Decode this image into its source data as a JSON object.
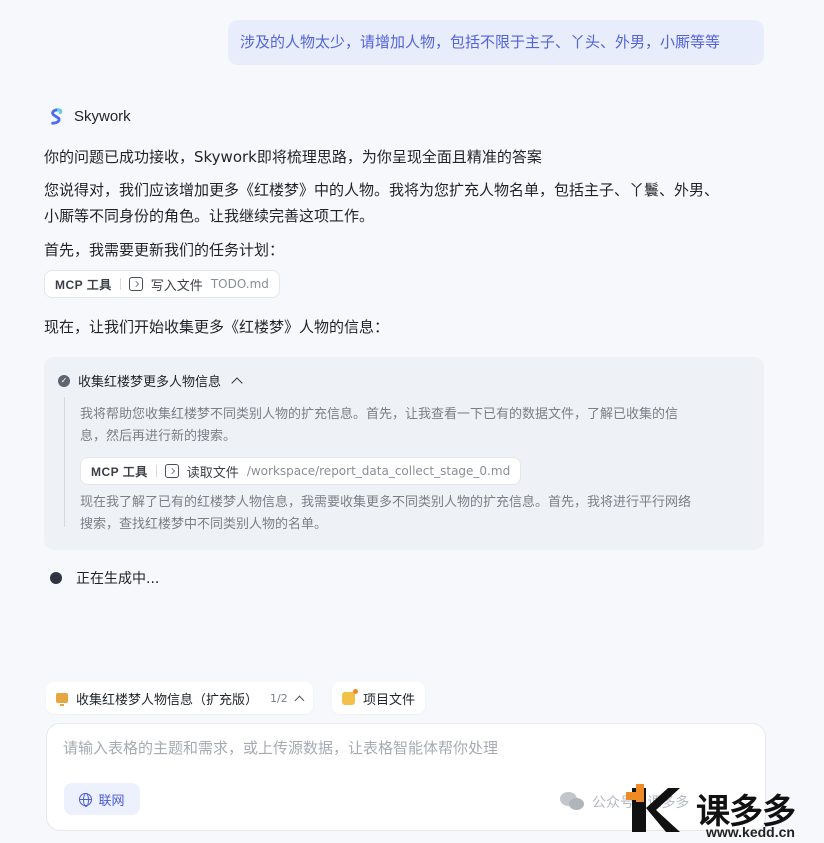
{
  "user_message": "涉及的人物太少，请增加人物，包括不限于主子、丫头、外男，小厮等等",
  "assistant": {
    "name": "Skywork",
    "paragraphs": [
      "你的问题已成功接收，Skywork即将梳理思路，为你呈现全面且精准的答案",
      "您说得对，我们应该增加更多《红楼梦》中的人物。我将为您扩充人物名单，包括主子、丫鬟、外男、",
      "小厮等不同身份的角色。让我继续完善这项工作。",
      "首先，我需要更新我们的任务计划："
    ],
    "tool_call_1": {
      "label": "MCP 工具",
      "action": "写入文件",
      "target": "TODO.md"
    },
    "next_paragraph": "现在，让我们开始收集更多《红楼梦》人物的信息：",
    "panel": {
      "title": "收集红楼梦更多人物信息",
      "text1_line1": "我将帮助您收集红楼梦不同类别人物的扩充信息。首先，让我查看一下已有的数据文件，了解已收集的信",
      "text1_line2": "息，然后再进行新的搜索。",
      "tool_call": {
        "label": "MCP 工具",
        "action": "读取文件",
        "target": "/workspace/report_data_collect_stage_0.md"
      },
      "text2_line1": "现在我了解了已有的红楼梦人物信息，我需要收集更多不同类别人物的扩充信息。首先，我将进行平行网络",
      "text2_line2": "搜索，查找红楼梦中不同类别人物的名单。"
    },
    "status": "正在生成中..."
  },
  "task_bar": {
    "task_label": "收集红楼梦人物信息（扩充版）",
    "task_count": "1/2",
    "files_label": "项目文件"
  },
  "composer": {
    "placeholder": "请输入表格的主题和需求，或上传源数据，让表格智能体帮你处理",
    "web_label": "联网"
  },
  "watermark": {
    "wechat_text": "公众号 · 课多多",
    "brand": "课多多",
    "url": "www.kedd.cn"
  }
}
